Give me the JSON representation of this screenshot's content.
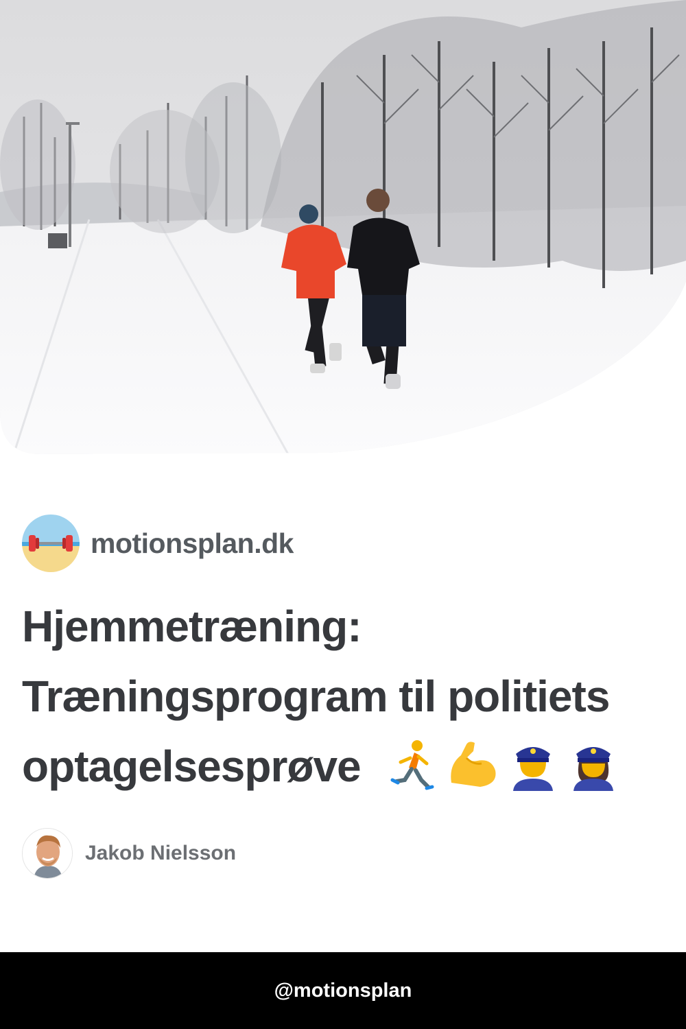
{
  "site": {
    "name": "motionsplan.dk",
    "logo_icon": "dumbbell-beach-logo"
  },
  "article": {
    "title_line1": "Hjemmetræning:",
    "title_line2": "Træningsprogram til politiets",
    "title_line3": "optagelsesprøve",
    "emojis": [
      "running-emoji",
      "flexed-biceps-emoji",
      "police-officer-emoji",
      "police-officer-emoji"
    ]
  },
  "author": {
    "name": "Jakob Nielsson"
  },
  "footer": {
    "handle": "@motionsplan"
  },
  "colors": {
    "title": "#37393d",
    "site_name": "#555a5f",
    "author_name": "#6c6f73",
    "footer_bg": "#000000",
    "footer_text": "#ffffff"
  }
}
